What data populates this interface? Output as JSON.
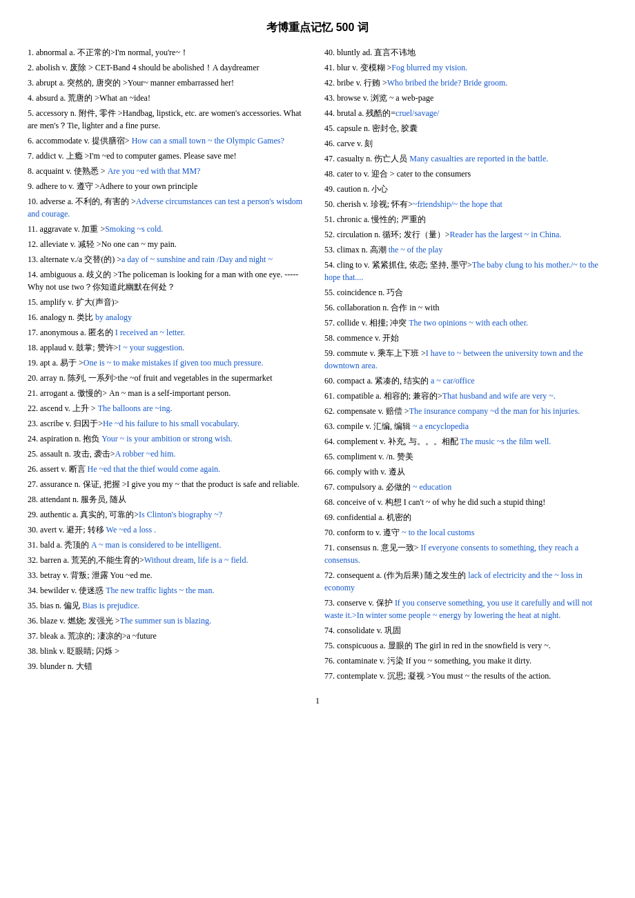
{
  "title": "考博重点记忆 500 词",
  "left_entries": [
    {
      "num": "1.",
      "text": "abnormal a. 不正常的>I'm normal, you're~！"
    },
    {
      "num": "2.",
      "text": "abolish v. 废除 > CET-Band 4 should be abolished！A daydreamer"
    },
    {
      "num": "3.",
      "text": "abrupt a. 突然的, 唐突的 >Your~ manner embarrassed her!"
    },
    {
      "num": "4.",
      "text": "absurd a. 荒唐的 >What an ~idea!"
    },
    {
      "num": "5.",
      "text": "accessory n. 附件, 零件 >Handbag, lipstick, etc. are women's accessories. What are men's？Tie, lighter and a fine purse."
    },
    {
      "num": "6.",
      "text": "accommodate v. 提供膳宿> How can a small town ~ the Olympic Games?",
      "blue_part": "How can a small town ~ the Olympic Games?"
    },
    {
      "num": "7.",
      "text": "addict v. 上瘾 >I'm ~ed to computer games. Please save me!"
    },
    {
      "num": "8.",
      "text": "acquaint v. 使熟悉 > Are you ~ed with that MM?",
      "blue_part": "Are you ~ed with that MM?"
    },
    {
      "num": "9.",
      "text": "adhere to v. 遵守 >Adhere to your own principle"
    },
    {
      "num": "10.",
      "text": "adverse a. 不利的, 有害的 >Adverse circumstances can test a person's wisdom and courage.",
      "blue_part": "Adverse circumstances can test a person's wisdom and courage."
    },
    {
      "num": "11.",
      "text": "aggravate v. 加重 >Smoking ~s cold.",
      "blue_part": "Smoking ~s cold."
    },
    {
      "num": "12.",
      "text": "alleviate v. 减轻 >No one can ~ my pain."
    },
    {
      "num": "13.",
      "text": "alternate v./a 交替(的) >a day of ~ sunshine and rain /Day and night ~",
      "blue_part": "a day of ~ sunshine and rain /Day and night ~"
    },
    {
      "num": "14.",
      "text": "ambiguous a. 歧义的 >The policeman is looking for a man with one eye. -----Why not use two？你知道此幽默在何处？"
    },
    {
      "num": "15.",
      "text": "amplify v. 扩大(声音)>"
    },
    {
      "num": "16.",
      "text": "analogy n. 类比 by analogy",
      "blue_part": "by analogy"
    },
    {
      "num": "17.",
      "text": "anonymous a. 匿名的 I received an ~ letter.",
      "blue_part": "I received an ~ letter."
    },
    {
      "num": "18.",
      "text": "applaud v. 鼓掌; 赞许>I ~ your suggestion.",
      "blue_part": "I ~ your suggestion."
    },
    {
      "num": "19.",
      "text": "apt a. 易于 >One is ~ to make mistakes if given too much pressure.",
      "blue_part": "One is ~ to make mistakes if given too much pressure."
    },
    {
      "num": "20.",
      "text": "array n. 陈列, 一系列>the ~of fruit and vegetables in the supermarket"
    },
    {
      "num": "21.",
      "text": "arrogant a. 傲慢的> An ~ man is a self-important person."
    },
    {
      "num": "22.",
      "text": "ascend v. 上升 > The balloons are ~ing.",
      "blue_part": "The balloons are ~ing."
    },
    {
      "num": "23.",
      "text": "ascribe v. 归因于>He ~d his failure to his small vocabulary.",
      "blue_part": "He ~d his failure to his small vocabulary."
    },
    {
      "num": "24.",
      "text": "aspiration n. 抱负 Your ~ is your ambition or strong wish.",
      "blue_part": "Your ~ is your ambition or strong wish."
    },
    {
      "num": "25.",
      "text": "assault n. 攻击, 袭击>A robber ~ed him.",
      "blue_part": "A robber ~ed him."
    },
    {
      "num": "26.",
      "text": "assert v. 断言 He ~ed that the thief would come again.",
      "blue_part": "He ~ed that the thief would come again."
    },
    {
      "num": "27.",
      "text": "assurance n. 保证, 把握 >I give you my ~ that the product is safe and reliable."
    },
    {
      "num": "28.",
      "text": "attendant n. 服务员, 随从"
    },
    {
      "num": "29.",
      "text": "authentic a. 真实的, 可靠的>Is Clinton's biography ~?",
      "blue_part": "Is Clinton's biography ~?"
    },
    {
      "num": "30.",
      "text": "avert v. 避开; 转移 We ~ed a loss .",
      "blue_part": "We ~ed a loss ."
    },
    {
      "num": "31.",
      "text": "bald a. 秃顶的 A ~ man is considered to be intelligent.",
      "blue_part": "A ~ man is considered to be intelligent."
    },
    {
      "num": "32.",
      "text": "barren a. 荒芜的,不能生育的>Without dream, life is a ~ field.",
      "blue_part": "Without dream, life is a ~ field."
    },
    {
      "num": "33.",
      "text": "betray v. 背叛; 泄露 You ~ed me."
    },
    {
      "num": "34.",
      "text": "bewilder v. 使迷惑 The new traffic lights ~ the man.",
      "blue_part": "The new traffic lights ~ the man."
    },
    {
      "num": "35.",
      "text": "bias n. 偏见 Bias is prejudice.",
      "blue_part": "Bias is prejudice."
    },
    {
      "num": "36.",
      "text": "blaze v. 燃烧; 发强光 >The summer sun is blazing.",
      "blue_part": "The summer sun is blazing."
    },
    {
      "num": "37.",
      "text": "bleak a. 荒凉的; 凄凉的>a ~future"
    },
    {
      "num": "38.",
      "text": "blink v. 眨眼睛; 闪烁 >"
    },
    {
      "num": "39.",
      "text": "blunder n. 大错"
    }
  ],
  "right_entries": [
    {
      "num": "40.",
      "text": "bluntly ad. 直言不讳地"
    },
    {
      "num": "41.",
      "text": "blur v. 变模糊 >Fog blurred my vision.",
      "blue_part": "Fog blurred my vision."
    },
    {
      "num": "42.",
      "text": "bribe v. 行贿 >Who bribed the bride? Bride groom.",
      "blue_part": "Who bribed the bride? Bride groom."
    },
    {
      "num": "43.",
      "text": "browse v. 浏览 ~ a web-page"
    },
    {
      "num": "44.",
      "text": "brutal a. 残酷的=cruel/savage/",
      "blue_part": "cruel/savage/"
    },
    {
      "num": "45.",
      "text": "capsule n. 密封仓, 胶囊"
    },
    {
      "num": "46.",
      "text": "carve v. 刻"
    },
    {
      "num": "47.",
      "text": "casualty n. 伤亡人员 Many casualties are reported in the battle.",
      "blue_part": "Many casualties are reported in the battle."
    },
    {
      "num": "48.",
      "text": "cater to v. 迎合 > cater to the consumers"
    },
    {
      "num": "49.",
      "text": "caution n. 小心"
    },
    {
      "num": "50.",
      "text": "cherish v. 珍视; 怀有>~friendship/~ the hope that",
      "blue_part": "~friendship/~ the hope that"
    },
    {
      "num": "51.",
      "text": "chronic a. 慢性的; 严重的"
    },
    {
      "num": "52.",
      "text": "circulation n. 循环; 发行（量）>Reader has the largest ~ in China.",
      "blue_part": "Reader has the largest ~ in China."
    },
    {
      "num": "53.",
      "text": "climax n. 高潮 the ~ of the play",
      "blue_part": "the ~ of the play"
    },
    {
      "num": "54.",
      "text": "cling to v. 紧紧抓住, 依恋; 坚持, 墨守>The baby clung to his mother./~ to the hope that....",
      "blue_part": "The baby clung to his mother./~ to the hope that...."
    },
    {
      "num": "55.",
      "text": "coincidence n. 巧合"
    },
    {
      "num": "56.",
      "text": "collaboration n. 合作 in ~ with"
    },
    {
      "num": "57.",
      "text": "collide v. 相撞; 冲突 The two opinions ~ with each other.",
      "blue_part": "The two opinions ~ with each other."
    },
    {
      "num": "58.",
      "text": "commence v. 开始"
    },
    {
      "num": "59.",
      "text": "commute v. 乘车上下班 >I have to ~ between the university town and the downtown area.",
      "blue_part": "I have to ~ between the university town and the downtown area."
    },
    {
      "num": "60.",
      "text": "compact a. 紧凑的, 结实的 a ~ car/office",
      "blue_part": "a ~ car/office"
    },
    {
      "num": "61.",
      "text": "compatible a. 相容的; 兼容的>That husband and wife are very ~.",
      "blue_part": "That husband and wife are very ~."
    },
    {
      "num": "62.",
      "text": "compensate v. 赔偿 >The insurance company ~d the man for his injuries.",
      "blue_part": "The insurance company ~d the man for his injuries."
    },
    {
      "num": "63.",
      "text": "compile v. 汇编, 编辑 ~ a encyclopedia",
      "blue_part": "~ a encyclopedia"
    },
    {
      "num": "64.",
      "text": "complement v. 补充, 与。。。相配 The music ~s the film well.",
      "blue_part": "The music ~s the film well."
    },
    {
      "num": "65.",
      "text": "compliment v. /n. 赞美"
    },
    {
      "num": "66.",
      "text": "comply with v. 遵从"
    },
    {
      "num": "67.",
      "text": "compulsory a. 必做的 ~ education",
      "blue_part": "~ education"
    },
    {
      "num": "68.",
      "text": "conceive of v. 构想 I can't ~ of why he did such a stupid thing!"
    },
    {
      "num": "69.",
      "text": "confidential a. 机密的"
    },
    {
      "num": "70.",
      "text": "conform to v. 遵守 ~ to the local customs",
      "blue_part": "~ to the local customs"
    },
    {
      "num": "71.",
      "text": "consensus n. 意见一致> If everyone consents to something, they reach a consensus.",
      "blue_part": "If everyone consents to something, they reach a consensus."
    },
    {
      "num": "72.",
      "text": "consequent a. (作为后果) 随之发生的 lack of electricity and the ~ loss in economy",
      "blue_part": "lack of electricity and the ~ loss in economy"
    },
    {
      "num": "73.",
      "text": "conserve v. 保护 If you conserve something, you use it carefully and will not waste it.>In winter some people ~ energy by lowering the heat at night.",
      "blue_part": "If you conserve something, you use it carefully and will not waste it.>In winter some people ~ energy by lowering the heat at night."
    },
    {
      "num": "74.",
      "text": "consolidate v. 巩固"
    },
    {
      "num": "75.",
      "text": "conspicuous a. 显眼的 The girl in red in the snowfield is very ~."
    },
    {
      "num": "76.",
      "text": "contaminate v. 污染 If you ~ something, you make it dirty."
    },
    {
      "num": "77.",
      "text": "contemplate v. 沉思; 凝视 >You must ~ the results of the action."
    }
  ],
  "page_number": "1"
}
